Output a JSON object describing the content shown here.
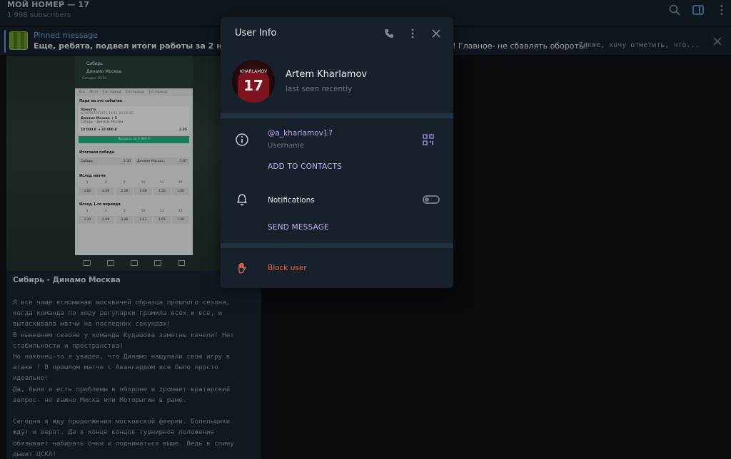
{
  "channel": {
    "title": "МОЙ НОМЕР — 17",
    "subscribers": "1 998 subscribers"
  },
  "pinned": {
    "label": "Pinned message",
    "text": "Еще, ребята, подвел итоги работы за 2 недели!",
    "text_right": "! Главное- не сбавлять обороты!",
    "text_tail": "Также, хочу отметить, что..."
  },
  "message": {
    "title": "Сибирь - Динамо Москва",
    "body": "Я все чаще вспоминаю москвичей образца прошлого сезона,\nкогда команда по ходу регулярки громила всех и все, и\nвытаскивала матчи на последних секундах!\nВ нынешнем сезоне у команды Кудашова заметны качели! Нет\nстабильности и пространства!\nНо наконец-то я увидел, что Динамо нащупали свою игру в\nатаке ! В прошлом матче с Авангардом все было просто\nидеально!\nДа, были и есть проблемы в обороне и хромает вратарский\nвопрос- не важно Миска или Моторыгин в раме.\n\nСегодня я жду продолжения московской феерии. Болельщики\nждут и верят. Да в конце концов турнирное положение\nобязывает набирать очки и подниматься выше. Ведь в спину\nдышит ЦСКА!",
    "screenshot": {
      "team1": "Сибирь",
      "team2": "Динамо Москва",
      "time": "Сегодня 19:30",
      "tabs": [
        "Все",
        "Матч",
        "1-й период",
        "2-й период",
        "3-й период"
      ],
      "section1": "Пари на это событие",
      "card_title": "Принято",
      "card_line1": "№ 00587267473  19:11  20.01.01",
      "card_pick": "Динамо Москва + 5",
      "card_match": "Сибирь – Динамо Москва",
      "card_total": "10 000 ₽ → 25 900 ₽",
      "card_coef": "2.35",
      "sell_btn": "Продать за 9 484 ₽",
      "section2": "Итоговая победа",
      "win_home": "Сибирь",
      "win_home_coef": "2.30",
      "win_away": "Динамо Москва",
      "win_away_coef": "1.67",
      "section3": "Исход матча",
      "outcome_labels": [
        "1",
        "X",
        "2",
        "1X",
        "12",
        "X2"
      ],
      "outcome_values": [
        "3.80",
        "4.00",
        "2.18",
        "1.68",
        "1.35",
        "1.40"
      ],
      "section4": "Исход 1-го периода",
      "period_values": [
        "3.30",
        "2.60",
        "3.40",
        "1.43",
        "1.65",
        "1.30"
      ]
    }
  },
  "user_info": {
    "title": "User Info",
    "avatar_number": "17",
    "avatar_name": "KHARLAMOV",
    "name": "Artem Kharlamov",
    "status": "last seen recently",
    "username": "@a_kharlamov17",
    "username_label": "Username",
    "add_contact": "ADD TO CONTACTS",
    "notifications": "Notifications",
    "notifications_on": false,
    "send_message": "SEND MESSAGE",
    "block": "Block user"
  },
  "colors": {
    "accent": "#5f9bd4",
    "link": "#b9a8ea",
    "danger": "#e0684f",
    "panel": "#17212b"
  },
  "icons": [
    "search-icon",
    "sidebar-toggle-icon",
    "more-icon",
    "close-icon",
    "phone-icon",
    "info-icon",
    "qr-code-icon",
    "bell-icon",
    "hand-stop-icon"
  ]
}
